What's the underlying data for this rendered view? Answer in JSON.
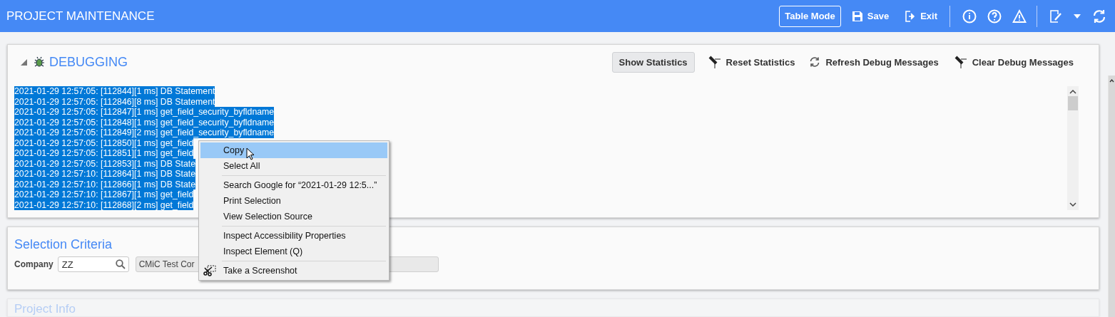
{
  "header": {
    "title": "PROJECT MAINTENANCE",
    "buttons": [
      {
        "kind": "outlined",
        "label": "Table Mode"
      },
      {
        "kind": "save",
        "label": "Save"
      },
      {
        "kind": "exit",
        "label": "Exit"
      }
    ]
  },
  "debugging": {
    "title": "DEBUGGING",
    "expanded": true,
    "actions": [
      {
        "kind": "button",
        "label": "Show Statistics"
      },
      {
        "kind": "broom",
        "label": "Reset Statistics"
      },
      {
        "kind": "refresh",
        "label": "Refresh Debug Messages"
      },
      {
        "kind": "broom",
        "label": "Clear Debug Messages"
      }
    ],
    "log": [
      {
        "text": "2021-01-29 12:57:05: [112844][1 ms] DB Statement",
        "selected": true
      },
      {
        "text": "2021-01-29 12:57:05: [112846][8 ms] DB Statement",
        "selected": true
      },
      {
        "text": "2021-01-29 12:57:05: [112847][1 ms] get_field_security_byfldname",
        "selected": true
      },
      {
        "text": "2021-01-29 12:57:05: [112848][1 ms] get_field_security_byfldname",
        "selected": true
      },
      {
        "text": "2021-01-29 12:57:05: [112849][2 ms] get_field_security_byfldname",
        "selected": true
      },
      {
        "text": "2021-01-29 12:57:05: [112850][1 ms] get_field",
        "selected": true
      },
      {
        "text": "2021-01-29 12:57:05: [112851][1 ms] get_field",
        "selected": true
      },
      {
        "text": "2021-01-29 12:57:05: [112853][1 ms] DB State",
        "selected": true
      },
      {
        "text": "2021-01-29 12:57:10: [112864][1 ms] DB State",
        "selected": true
      },
      {
        "text": "2021-01-29 12:57:10: [112866][1 ms] DB State",
        "selected": true
      },
      {
        "text": "2021-01-29 12:57:10: [112867][1 ms] get_field",
        "selected": true
      },
      {
        "text": "2021-01-29 12:57:10: [112868][2 ms] get_field",
        "selected": true
      }
    ]
  },
  "selection_criteria": {
    "title": "Selection Criteria",
    "company_label": "Company",
    "company_value": "ZZ",
    "company_name": "CMiC Test Cor"
  },
  "project_info": {
    "title": "Project Info"
  },
  "context_menu": [
    {
      "kind": "item",
      "label": "Copy",
      "selected": true
    },
    {
      "kind": "item",
      "label": "Select All",
      "selected": false
    },
    {
      "kind": "separator"
    },
    {
      "kind": "item",
      "label": "Search Google for “2021-01-29 12:5...”",
      "selected": false
    },
    {
      "kind": "item",
      "label": "Print Selection",
      "selected": false
    },
    {
      "kind": "item",
      "label": "View Selection Source",
      "selected": false
    },
    {
      "kind": "separator"
    },
    {
      "kind": "item",
      "label": "Inspect Accessibility Properties",
      "selected": false
    },
    {
      "kind": "item",
      "label": "Inspect Element (Q)",
      "selected": false
    },
    {
      "kind": "separator"
    },
    {
      "kind": "screenshot",
      "label": "Take a Screenshot",
      "selected": false
    }
  ]
}
